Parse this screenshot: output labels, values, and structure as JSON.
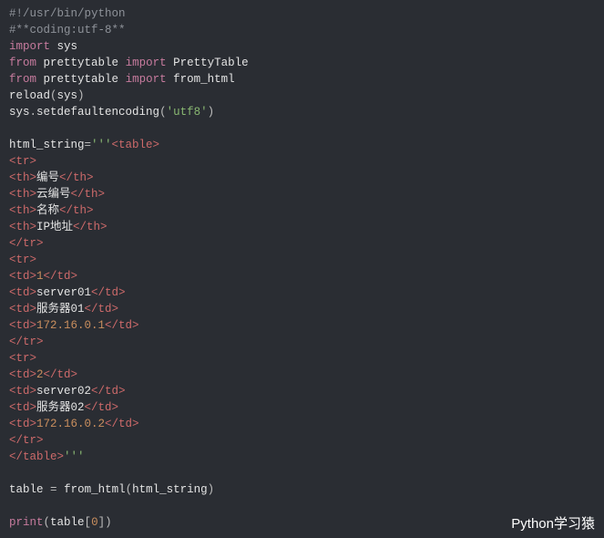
{
  "code": {
    "shebang": "#!/usr/bin/python",
    "coding": "#**coding:utf-8**",
    "import_sys": "import sys",
    "from_pt1": "from prettytable import PrettyTable",
    "from_pt2": "from prettytable import from_html",
    "reload": "reload(sys)",
    "setenc": "sys.setdefaultencoding('utf8')",
    "html_assign": "html_string='''",
    "tag_table_o": "<table>",
    "tag_tr_o": "<tr>",
    "tag_tr_c": "</tr>",
    "tag_th_o": "<th>",
    "tag_th_c": "</th>",
    "tag_td_o": "<td>",
    "tag_td_c": "</td>",
    "tag_table_c": "</table>",
    "triple_q": "'''",
    "th1": "编号",
    "th2": "云编号",
    "th3": "名称",
    "th4": "IP地址",
    "r1c1": "1",
    "r1c2": "server01",
    "r1c3": "服务器01",
    "r1c4": "172.16.0.1",
    "r2c1": "2",
    "r2c2": "server02",
    "r2c3": "服务器02",
    "r2c4": "172.16.0.2",
    "table_assign": "table = from_html(html_string)",
    "print_stmt": "print(table[0])"
  },
  "watermark": "Python学习猿"
}
